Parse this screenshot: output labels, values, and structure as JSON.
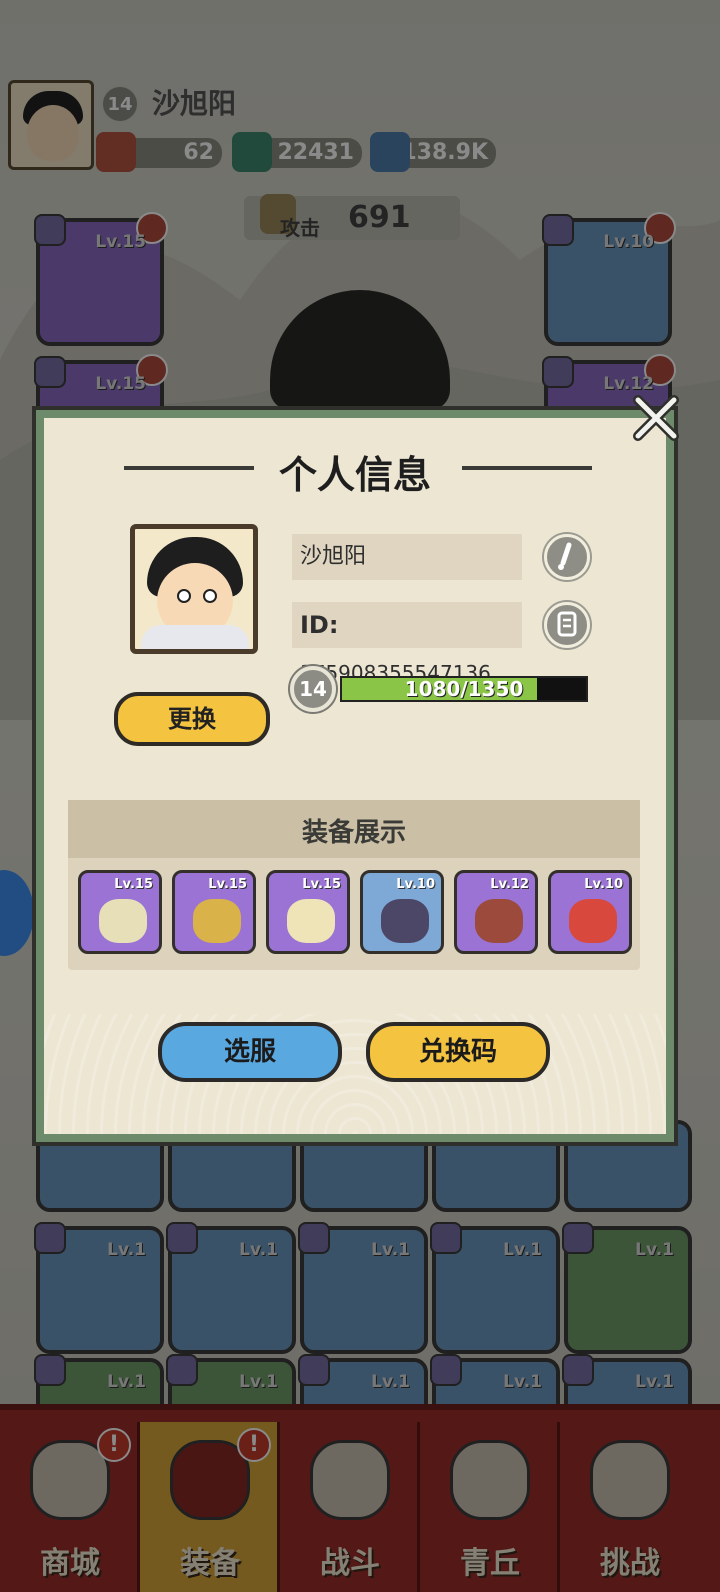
{
  "background": {
    "player_level": "14",
    "player_name": "沙旭阳",
    "resources": [
      {
        "icon": "gift-icon",
        "value": "62"
      },
      {
        "icon": "jade-icon",
        "value": "22431"
      },
      {
        "icon": "crystal-icon",
        "value": "138.9K"
      }
    ],
    "attack_label": "攻击",
    "attack_value": "691",
    "top_slots": [
      {
        "level": "Lv.15"
      },
      {
        "level": "Lv.10"
      },
      {
        "level": "Lv.15"
      },
      {
        "level": "Lv.12"
      }
    ],
    "inventory_row1": [
      {
        "level": "Lv.1"
      },
      {
        "level": "Lv.1"
      },
      {
        "level": "Lv.1"
      },
      {
        "level": "Lv.1"
      },
      {
        "level": "Lv.1"
      }
    ],
    "inventory_row2": [
      {
        "level": "Lv.1"
      },
      {
        "level": "Lv.1"
      },
      {
        "level": "Lv.1"
      },
      {
        "level": "Lv.1"
      },
      {
        "level": "Lv.1"
      }
    ]
  },
  "nav": {
    "items": [
      {
        "label": "商城",
        "icon": "shop-icon",
        "alert": "!"
      },
      {
        "label": "装备",
        "icon": "armor-icon",
        "alert": "!"
      },
      {
        "label": "战斗",
        "icon": "crossed-swords-icon"
      },
      {
        "label": "青丘",
        "icon": "mountain-icon"
      },
      {
        "label": "挑战",
        "icon": "challenge-icon"
      }
    ]
  },
  "modal": {
    "title": "个人信息",
    "name": "沙旭阳",
    "id_prefix": "ID:",
    "id_value": "375908355547136",
    "level": "14",
    "xp_text": "1080/1350",
    "xp_fraction": 0.8,
    "swap_label": "更换",
    "equip_title": "装备展示",
    "equipment": [
      {
        "level": "Lv.15",
        "rarity": "purple",
        "icon": "ribbon-icon"
      },
      {
        "level": "Lv.15",
        "rarity": "purple",
        "icon": "golden-armor-icon"
      },
      {
        "level": "Lv.15",
        "rarity": "purple",
        "icon": "golden-helmet-icon"
      },
      {
        "level": "Lv.10",
        "rarity": "blue",
        "icon": "belt-icon"
      },
      {
        "level": "Lv.12",
        "rarity": "purple",
        "icon": "boots-icon"
      },
      {
        "level": "Lv.10",
        "rarity": "purple",
        "icon": "orb-icon"
      }
    ],
    "server_label": "选服",
    "code_label": "兑换码"
  }
}
